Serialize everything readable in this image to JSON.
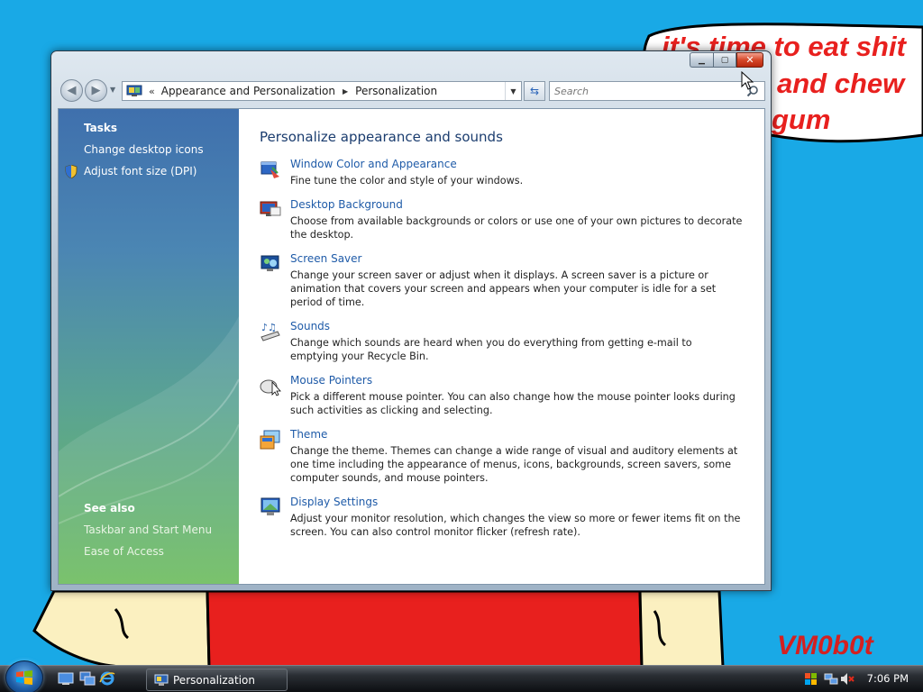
{
  "desktop": {
    "bubble_lines": [
      "it's time to eat shit",
      "and chew",
      "gum"
    ],
    "signature": "VM0b0t"
  },
  "window": {
    "address": {
      "chevron": "«",
      "crumbs": [
        "Appearance and Personalization",
        "Personalization"
      ]
    },
    "search": {
      "placeholder": "Search"
    },
    "sidebar": {
      "tasks_title": "Tasks",
      "tasks": [
        {
          "label": "Change desktop icons",
          "icon": null
        },
        {
          "label": "Adjust font size (DPI)",
          "icon": "shield-icon"
        }
      ],
      "see_also_title": "See also",
      "see_also": [
        {
          "label": "Taskbar and Start Menu"
        },
        {
          "label": "Ease of Access"
        }
      ]
    },
    "main": {
      "heading": "Personalize appearance and sounds",
      "items": [
        {
          "title": "Window Color and Appearance",
          "icon": "window-color-icon",
          "desc": "Fine tune the color and style of your windows."
        },
        {
          "title": "Desktop Background",
          "icon": "desktop-background-icon",
          "desc": "Choose from available backgrounds or colors or use one of your own pictures to decorate the desktop."
        },
        {
          "title": "Screen Saver",
          "icon": "screen-saver-icon",
          "desc": "Change your screen saver or adjust when it displays. A screen saver is a picture or animation that covers your screen and appears when your computer is idle for a set period of time."
        },
        {
          "title": "Sounds",
          "icon": "sounds-icon",
          "desc": "Change which sounds are heard when you do everything from getting e-mail to emptying your Recycle Bin."
        },
        {
          "title": "Mouse Pointers",
          "icon": "mouse-pointer-icon",
          "desc": "Pick a different mouse pointer. You can also change how the mouse pointer looks during such activities as clicking and selecting."
        },
        {
          "title": "Theme",
          "icon": "theme-icon",
          "desc": "Change the theme. Themes can change a wide range of visual and auditory elements at one time including the appearance of menus, icons, backgrounds, screen savers, some computer sounds, and mouse pointers."
        },
        {
          "title": "Display Settings",
          "icon": "display-settings-icon",
          "desc": "Adjust your monitor resolution, which changes the view so more or fewer items fit on the screen. You can also control monitor flicker (refresh rate)."
        }
      ]
    }
  },
  "taskbar": {
    "active_task": "Personalization",
    "clock": "7:06 PM"
  },
  "colors": {
    "desktop": "#19a9e6",
    "link": "#1f5ba8",
    "heading": "#1a3c6e",
    "bubble_text": "#e8201e"
  }
}
